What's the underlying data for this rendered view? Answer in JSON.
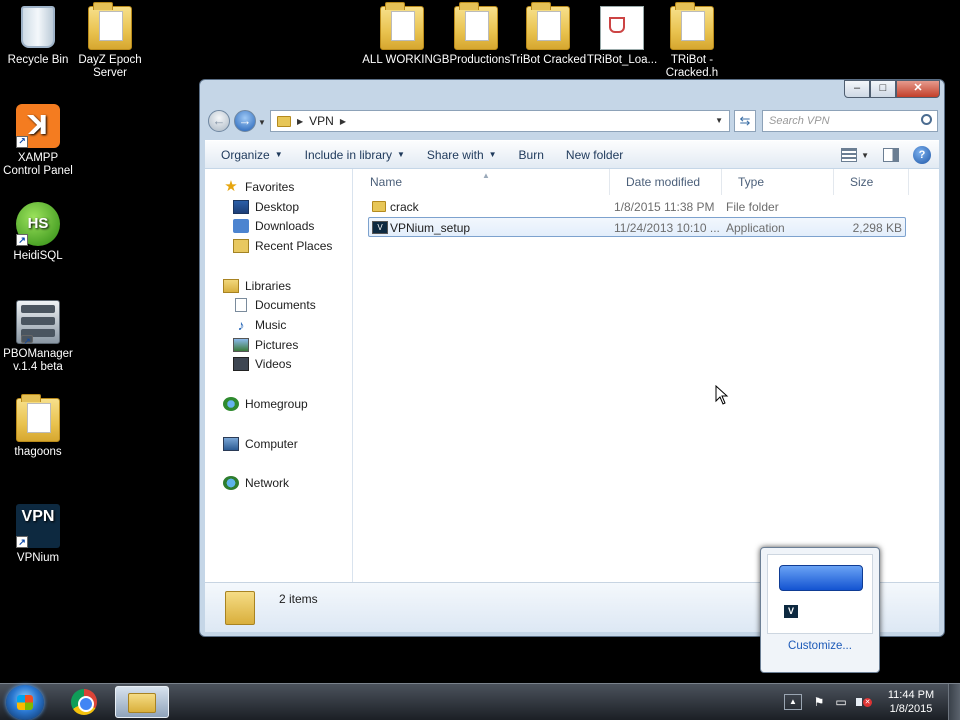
{
  "desktop": {
    "icons": [
      {
        "label": "Recycle Bin",
        "icon": "recycle-bin-icon"
      },
      {
        "label": "DayZ Epoch Server",
        "icon": "folder-icon"
      },
      {
        "label": "XAMPP Control Panel",
        "icon": "xampp-icon"
      },
      {
        "label": "HeidiSQL",
        "icon": "heidisql-icon"
      },
      {
        "label": "PBOManager v.1.4 beta",
        "icon": "pbomanager-icon"
      },
      {
        "label": "thagoons",
        "icon": "folder-icon"
      },
      {
        "label": "VPNium",
        "icon": "vpnium-icon"
      },
      {
        "label": "ALL WORKING",
        "icon": "folder-icon"
      },
      {
        "label": "BProductions",
        "icon": "folder-icon"
      },
      {
        "label": "TriBot Cracked",
        "icon": "folder-icon"
      },
      {
        "label": "TRiBot_Loa...",
        "icon": "java-file-icon"
      },
      {
        "label": "TRiBot - Cracked.h",
        "icon": "folder-icon"
      }
    ],
    "icon_glyphs": {
      "xampp": "ꓘ",
      "heidisql": "HS",
      "vpnium": "VPN"
    }
  },
  "window": {
    "caption": {
      "min": "–",
      "max": "□",
      "close": "✕"
    },
    "address": {
      "crumb": "VPN"
    },
    "search_placeholder": "Search VPN",
    "toolbar": {
      "organize": "Organize",
      "include": "Include in library",
      "share": "Share with",
      "burn": "Burn",
      "new_folder": "New folder",
      "help": "?"
    },
    "nav": {
      "favorites": "Favorites",
      "desktop": "Desktop",
      "downloads": "Downloads",
      "recent": "Recent Places",
      "libraries": "Libraries",
      "documents": "Documents",
      "music": "Music",
      "pictures": "Pictures",
      "videos": "Videos",
      "homegroup": "Homegroup",
      "computer": "Computer",
      "network": "Network"
    },
    "columns": {
      "name": "Name",
      "date": "Date modified",
      "type": "Type",
      "size": "Size"
    },
    "files": [
      {
        "name": "crack",
        "date": "1/8/2015 11:38 PM",
        "type": "File folder",
        "size": ""
      },
      {
        "name": "VPNium_setup",
        "date": "11/24/2013 10:10 ...",
        "type": "Application",
        "size": "2,298 KB"
      }
    ],
    "details": {
      "count": "2 items"
    }
  },
  "tray_popup": {
    "customize": "Customize...",
    "app_glyph": "V"
  },
  "taskbar": {
    "time": "11:44 PM",
    "date": "1/8/2015"
  }
}
